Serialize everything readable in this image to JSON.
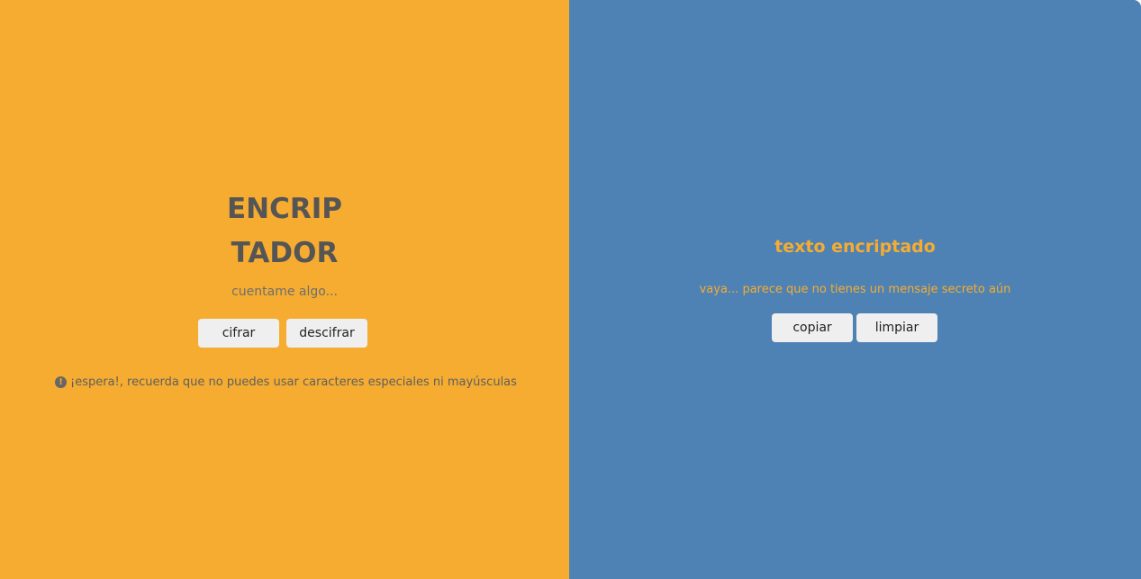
{
  "encoder": {
    "title_line1": "ENCRIP",
    "title_line2": "TADOR",
    "input_placeholder": "cuentame algo...",
    "encrypt_label": "cifrar",
    "decrypt_label": "descifrar",
    "warning_icon": "alert-circle-icon",
    "warning_text": "¡espera!, recuerda que no puedes usar caracteres especiales ni mayúsculas"
  },
  "output": {
    "title": "texto encriptado",
    "empty_message": "vaya... parece que no tienes un mensaje secreto aún",
    "copy_label": "copiar",
    "clear_label": "limpiar"
  },
  "colors": {
    "left_background": "#f5ac30",
    "right_background": "#4f82b4",
    "title_text": "#555555",
    "accent_text": "#f5ac30",
    "button_background": "#efefef"
  }
}
